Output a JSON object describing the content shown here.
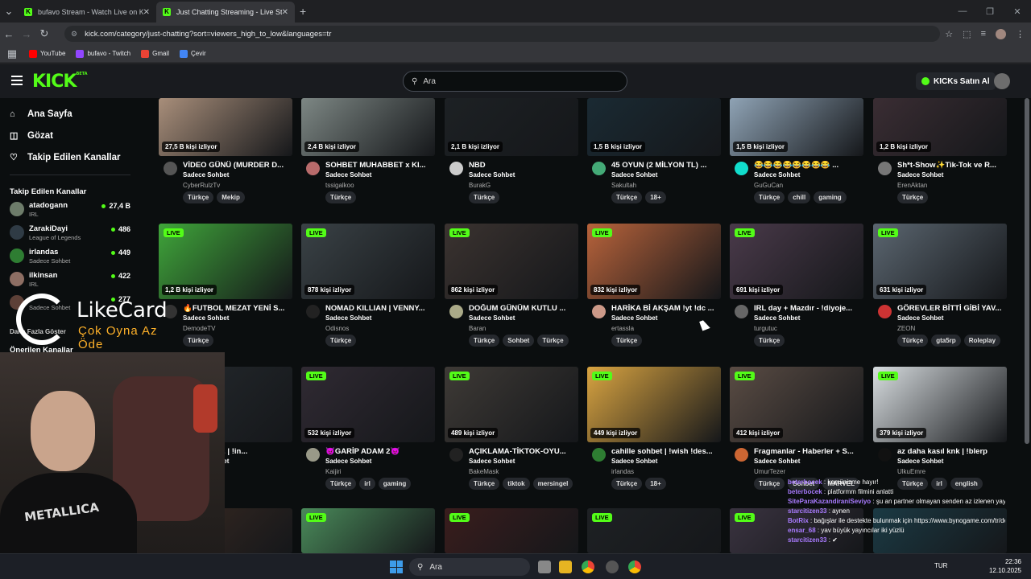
{
  "browser": {
    "tabs": [
      {
        "title": "bufavo Stream - Watch Live on Kick",
        "active": false
      },
      {
        "title": "Just Chatting Streaming - Live Streams",
        "active": true
      }
    ],
    "url": "kick.com/category/just-chatting?sort=viewers_high_to_low&languages=tr",
    "bookmarks": [
      "YouTube",
      "bufavo - Twitch",
      "Gmail",
      "Çevir"
    ]
  },
  "header": {
    "logo": "KICK",
    "logo_sup": "BETA",
    "search_placeholder": "Ara",
    "kicks_button": "KICKs Satın Al"
  },
  "sidebar": {
    "nav": [
      "Ana Sayfa",
      "Gözat",
      "Takip Edilen Kanallar"
    ],
    "followed_title": "Takip Edilen Kanallar",
    "followed": [
      {
        "name": "atadogann",
        "category": "IRL",
        "viewers": "27,4 B",
        "color": "#6d7c6a"
      },
      {
        "name": "ZarakiDayi",
        "category": "League of Legends",
        "viewers": "486",
        "color": "#2f3b45"
      },
      {
        "name": "irlandas",
        "category": "Sadece Sohbet",
        "viewers": "449",
        "color": "#2e7d32"
      },
      {
        "name": "ilkinsan",
        "category": "IRL",
        "viewers": "422",
        "color": "#8d6e63"
      },
      {
        "name": "",
        "category": "Sadece Sohbet",
        "viewers": "277",
        "color": "#5d4037"
      }
    ],
    "more_label": "Daha Fazla Göster",
    "suggested_title": "Önerilen Kanallar"
  },
  "overlay": {
    "brand": "LikeCard",
    "tagline": "Çok Oyna  Az Öde"
  },
  "streams": [
    {
      "title": "VİDEO GÜNÜ (MURDER D...",
      "category": "Sadece Sohbet",
      "channel": "CyberRulzTv",
      "viewers": "27,5 B kişi izliyor",
      "tags": [
        "Türkçe",
        "Mekip"
      ],
      "live": false,
      "color": "#a88e7a",
      "avatar": "#555"
    },
    {
      "title": "SOHBET MUHABBET x KI...",
      "category": "Sadece Sohbet",
      "channel": "tssigalkoo",
      "viewers": "2,4 B kişi izliyor",
      "tags": [
        "Türkçe"
      ],
      "live": false,
      "color": "#7d8784",
      "avatar": "#b86b6b"
    },
    {
      "title": "NBD",
      "category": "Sadece Sohbet",
      "channel": "BurakG",
      "viewers": "2,1 B kişi izliyor",
      "tags": [
        "Türkçe"
      ],
      "live": false,
      "color": "#1d2124",
      "avatar": "#ccc"
    },
    {
      "title": "45 OYUN (2 MİLYON TL) ...",
      "category": "Sadece Sohbet",
      "channel": "Sakultah",
      "viewers": "1,5 B kişi izliyor",
      "tags": [
        "Türkçe",
        "18+"
      ],
      "live": false,
      "color": "#1a2a33",
      "avatar": "#4a7"
    },
    {
      "title": "😂😂😂😂😂😂😂😂 ...",
      "category": "Sadece Sohbet",
      "channel": "GuGuCan",
      "viewers": "1,5 B kişi izliyor",
      "tags": [
        "Türkçe",
        "chill",
        "gaming"
      ],
      "live": false,
      "color": "#8fa3b5",
      "avatar": "#1dc"
    },
    {
      "title": "Sh*t-Show✨Tik-Tok ve R...",
      "category": "Sadece Sohbet",
      "channel": "ErenAktan",
      "viewers": "1,2 B kişi izliyor",
      "tags": [
        "Türkçe"
      ],
      "live": false,
      "color": "#3a2d33",
      "avatar": "#777"
    },
    {
      "title": "🔥FUTBOL MEZAT YENİ S...",
      "category": "Sadece Sohbet",
      "channel": "DemodeTV",
      "viewers": "1,2 B kişi izliyor",
      "tags": [
        "Türkçe"
      ],
      "live": true,
      "color": "#3fa53a",
      "avatar": "#333"
    },
    {
      "title": "NOMAD KILLIAN | VENNY...",
      "category": "Sadece Sohbet",
      "channel": "Odisnos",
      "viewers": "878 kişi izliyor",
      "tags": [
        "Türkçe"
      ],
      "live": true,
      "color": "#3a4246",
      "avatar": "#222"
    },
    {
      "title": "DOĞUM GÜNÜM KUTLU ...",
      "category": "Sadece Sohbet",
      "channel": "Baran",
      "viewers": "862 kişi izliyor",
      "tags": [
        "Türkçe",
        "Sohbet",
        "Türkçe"
      ],
      "live": true,
      "color": "#3b3330",
      "avatar": "#aa8"
    },
    {
      "title": "HARİKA Bİ AKŞAM !yt !dc ...",
      "category": "Sadece Sohbet",
      "channel": "ertassla",
      "viewers": "832 kişi izliyor",
      "tags": [
        "Türkçe"
      ],
      "live": true,
      "color": "#b8633b",
      "avatar": "#c98"
    },
    {
      "title": "IRL day + Mazdır - !diyoje...",
      "category": "Sadece Sohbet",
      "channel": "turgutuc",
      "viewers": "691 kişi izliyor",
      "tags": [
        "Türkçe"
      ],
      "live": true,
      "color": "#4a3a4a",
      "avatar": "#666"
    },
    {
      "title": "GÖREVLER BİTTİ GİBİ YAV...",
      "category": "Sadece Sohbet",
      "channel": "ZEON",
      "viewers": "631 kişi izliyor",
      "tags": [
        "Türkçe",
        "gta5rp",
        "Roleplay"
      ],
      "live": true,
      "color": "#5b6670",
      "avatar": "#c33"
    },
    {
      "title": "...ım ağrıyo. | !in...",
      "category": "Sadece Sohbet",
      "channel": "et",
      "viewers": "",
      "tags": [],
      "live": false,
      "color": "#252a2e",
      "avatar": "#444"
    },
    {
      "title": "😈GARİP ADAM 2😈",
      "category": "Sadece Sohbet",
      "channel": "Kaijiri",
      "viewers": "532 kişi izliyor",
      "tags": [
        "Türkçe",
        "irl",
        "gaming"
      ],
      "live": true,
      "color": "#302a33",
      "avatar": "#998"
    },
    {
      "title": "AÇIKLAMA-TİKTOK-OYU...",
      "category": "Sadece Sohbet",
      "channel": "BakeMask",
      "viewers": "489 kişi izliyor",
      "tags": [
        "Türkçe",
        "tiktok",
        "mersingel"
      ],
      "live": true,
      "color": "#3e3a36",
      "avatar": "#222"
    },
    {
      "title": "cahille sohbet | !wish !des...",
      "category": "Sadece Sohbet",
      "channel": "irlandas",
      "viewers": "449 kişi izliyor",
      "tags": [
        "Türkçe",
        "18+"
      ],
      "live": true,
      "color": "#d9a441",
      "avatar": "#2e7d32"
    },
    {
      "title": "Fragmanlar - Haberler + S...",
      "category": "Sadece Sohbet",
      "channel": "UmurTezer",
      "viewers": "412 kişi izliyor",
      "tags": [
        "Türkçe",
        "Sohbet",
        "MARVEL"
      ],
      "live": true,
      "color": "#5a4c44",
      "avatar": "#c63"
    },
    {
      "title": "az daha kasıl knk | !blerp",
      "category": "Sadece Sohbet",
      "channel": "UlkuEmre",
      "viewers": "379 kişi izliyor",
      "tags": [
        "Türkçe",
        "irl",
        "english"
      ],
      "live": true,
      "color": "#d8dde0",
      "avatar": "#111"
    },
    {
      "title": "",
      "category": "",
      "channel": "",
      "viewers": "",
      "tags": [],
      "live": false,
      "color": "#3a2a22",
      "avatar": "#333"
    },
    {
      "title": "",
      "category": "",
      "channel": "",
      "viewers": "",
      "tags": [],
      "live": true,
      "color": "#4a8a5a",
      "avatar": "#333"
    },
    {
      "title": "",
      "category": "",
      "channel": "",
      "viewers": "",
      "tags": [],
      "live": true,
      "color": "#3a1d1d",
      "avatar": "#333"
    },
    {
      "title": "",
      "category": "",
      "channel": "",
      "viewers": "",
      "tags": [],
      "live": true,
      "color": "#1e2124",
      "avatar": "#333"
    },
    {
      "title": "",
      "category": "",
      "channel": "",
      "viewers": "",
      "tags": [],
      "live": true,
      "color": "#3a3340",
      "avatar": "#333"
    },
    {
      "title": "",
      "category": "",
      "channel": "",
      "viewers": "",
      "tags": [],
      "live": false,
      "color": "#1b3a44",
      "avatar": "#333"
    }
  ],
  "chat": [
    {
      "user": "beterbocek",
      "text": "komünizme hayır!"
    },
    {
      "user": "beterbocek",
      "text": "platformm filmini anlatti"
    },
    {
      "user": "SiteParaKazandiraniSeviyo",
      "text": "şu an partner olmayan senden az izlenen yayıncıları sen sikliyo musun? sadece dediğin için sordum"
    },
    {
      "user": "starcitizen33",
      "text": "aynen"
    },
    {
      "user": "BotRix",
      "text": "bağışlar ile destekte bulunmak için https://www.bynogame.com/tr/destekle/bufavo"
    },
    {
      "user": "ensar_68",
      "text": "yav büyük yayıncılar iki yüzlü"
    },
    {
      "user": "starcitizen33",
      "text": "✔"
    }
  ],
  "taskbar": {
    "search": "Ara",
    "lang": "TUR",
    "time": "22:36",
    "date": "12.10.2025"
  }
}
